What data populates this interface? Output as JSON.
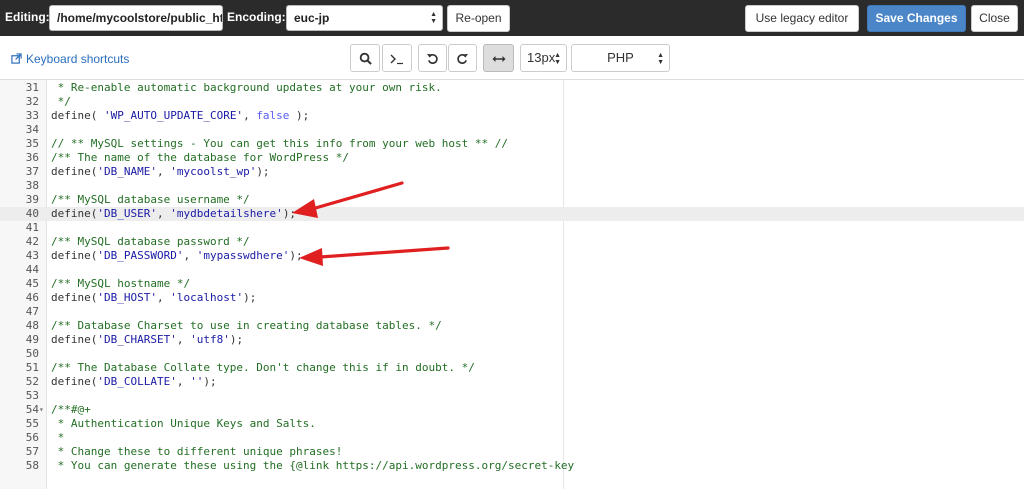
{
  "topbar": {
    "editing_label": "Editing:",
    "path_value": "/home/mycoolstore/public_html/wp-config.php",
    "encoding_label": "Encoding:",
    "encoding_value": "euc-jp",
    "reopen_label": "Re-open",
    "legacy_label": "Use legacy editor",
    "save_label": "Save Changes",
    "close_label": "Close"
  },
  "toolbar": {
    "shortcuts_label": "Keyboard shortcuts",
    "font_size": "13px",
    "language": "PHP"
  },
  "colors": {
    "comment": "#236e24",
    "string": "#1a1aa6",
    "keyword": "#585cf6",
    "arrow": "#e02020",
    "primary_button": "#4a86c8"
  },
  "editor": {
    "lines": [
      {
        "n": "31",
        "parts": [
          {
            "t": " * Re-enable automatic background updates at your own risk.",
            "c": "comment"
          }
        ]
      },
      {
        "n": "32",
        "parts": [
          {
            "t": " */",
            "c": "comment"
          }
        ]
      },
      {
        "n": "33",
        "parts": [
          {
            "t": "define( ",
            "c": "func"
          },
          {
            "t": "'WP_AUTO_UPDATE_CORE'",
            "c": "string"
          },
          {
            "t": ", ",
            "c": "func"
          },
          {
            "t": "false",
            "c": "bool"
          },
          {
            "t": " );",
            "c": "func"
          }
        ]
      },
      {
        "n": "34",
        "parts": []
      },
      {
        "n": "35",
        "parts": [
          {
            "t": "// ** MySQL settings - You can get this info from your web host ** //",
            "c": "comment"
          }
        ]
      },
      {
        "n": "36",
        "parts": [
          {
            "t": "/** The name of the database for WordPress */",
            "c": "comment"
          }
        ]
      },
      {
        "n": "37",
        "parts": [
          {
            "t": "define(",
            "c": "func"
          },
          {
            "t": "'DB_NAME'",
            "c": "string"
          },
          {
            "t": ", ",
            "c": "func"
          },
          {
            "t": "'mycoolst_wp'",
            "c": "string"
          },
          {
            "t": ");",
            "c": "func"
          }
        ]
      },
      {
        "n": "38",
        "parts": []
      },
      {
        "n": "39",
        "parts": [
          {
            "t": "/** MySQL database username */",
            "c": "comment"
          }
        ]
      },
      {
        "n": "40",
        "hl": true,
        "parts": [
          {
            "t": "define(",
            "c": "func"
          },
          {
            "t": "'DB_USER'",
            "c": "string"
          },
          {
            "t": ", ",
            "c": "func"
          },
          {
            "t": "'mydbdetailshere'",
            "c": "string"
          },
          {
            "t": ");",
            "c": "func"
          }
        ]
      },
      {
        "n": "41",
        "parts": []
      },
      {
        "n": "42",
        "parts": [
          {
            "t": "/** MySQL database password */",
            "c": "comment"
          }
        ]
      },
      {
        "n": "43",
        "parts": [
          {
            "t": "define(",
            "c": "func"
          },
          {
            "t": "'DB_PASSWORD'",
            "c": "string"
          },
          {
            "t": ", ",
            "c": "func"
          },
          {
            "t": "'mypasswdhere'",
            "c": "string"
          },
          {
            "t": ");",
            "c": "func"
          }
        ]
      },
      {
        "n": "44",
        "parts": []
      },
      {
        "n": "45",
        "parts": [
          {
            "t": "/** MySQL hostname */",
            "c": "comment"
          }
        ]
      },
      {
        "n": "46",
        "parts": [
          {
            "t": "define(",
            "c": "func"
          },
          {
            "t": "'DB_HOST'",
            "c": "string"
          },
          {
            "t": ", ",
            "c": "func"
          },
          {
            "t": "'localhost'",
            "c": "string"
          },
          {
            "t": ");",
            "c": "func"
          }
        ]
      },
      {
        "n": "47",
        "parts": []
      },
      {
        "n": "48",
        "parts": [
          {
            "t": "/** Database Charset to use in creating database tables. */",
            "c": "comment"
          }
        ]
      },
      {
        "n": "49",
        "parts": [
          {
            "t": "define(",
            "c": "func"
          },
          {
            "t": "'DB_CHARSET'",
            "c": "string"
          },
          {
            "t": ", ",
            "c": "func"
          },
          {
            "t": "'utf8'",
            "c": "string"
          },
          {
            "t": ");",
            "c": "func"
          }
        ]
      },
      {
        "n": "50",
        "parts": []
      },
      {
        "n": "51",
        "parts": [
          {
            "t": "/** The Database Collate type. Don't change this if in doubt. */",
            "c": "comment"
          }
        ]
      },
      {
        "n": "52",
        "parts": [
          {
            "t": "define(",
            "c": "func"
          },
          {
            "t": "'DB_COLLATE'",
            "c": "string"
          },
          {
            "t": ", ",
            "c": "func"
          },
          {
            "t": "''",
            "c": "string"
          },
          {
            "t": ");",
            "c": "func"
          }
        ]
      },
      {
        "n": "53",
        "parts": []
      },
      {
        "n": "54",
        "fold": true,
        "parts": [
          {
            "t": "/**#@+",
            "c": "comment"
          }
        ]
      },
      {
        "n": "55",
        "parts": [
          {
            "t": " * Authentication Unique Keys and Salts.",
            "c": "comment"
          }
        ]
      },
      {
        "n": "56",
        "parts": [
          {
            "t": " *",
            "c": "comment"
          }
        ]
      },
      {
        "n": "57",
        "parts": [
          {
            "t": " * Change these to different unique phrases!",
            "c": "comment"
          }
        ]
      },
      {
        "n": "58",
        "parts": [
          {
            "t": " * You can generate these using the {@link https://api.wordpress.org/secret-key",
            "c": "comment"
          }
        ]
      }
    ]
  }
}
